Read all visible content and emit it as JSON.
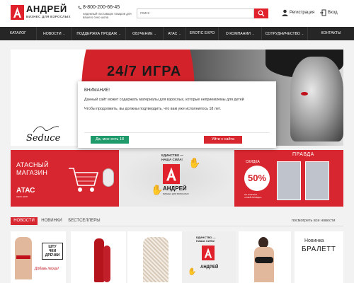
{
  "header": {
    "logo_letter": "А",
    "logo_name": "АНДРЕЙ",
    "logo_subtitle": "БИЗНЕС ДЛЯ ВЗРОСЛЫХ",
    "phone": "8-800-200-66-45",
    "tagline": "надежный поставщик товаров для вашего секс-шопа",
    "search_placeholder": "поиск",
    "register_label": "Регистрация",
    "login_label": "Вход"
  },
  "nav": {
    "items": [
      {
        "label": "КАТАЛОГ",
        "has_dropdown": false
      },
      {
        "label": "НОВОСТИ",
        "has_dropdown": true
      },
      {
        "label": "ПОДДЕРЖКА ПРОДАЖ",
        "has_dropdown": true
      },
      {
        "label": "ОБУЧЕНИЕ",
        "has_dropdown": true
      },
      {
        "label": "АТАС",
        "has_dropdown": true
      },
      {
        "label": "EROTIC EXPO",
        "has_dropdown": false
      },
      {
        "label": "О КОМПАНИИ",
        "has_dropdown": true
      },
      {
        "label": "СОТРУДНИЧЕСТВО",
        "has_dropdown": true
      },
      {
        "label": "КОНТАКТЫ",
        "has_dropdown": false
      }
    ]
  },
  "hero": {
    "title": "24/7 ИГРА",
    "brand_signature": "Seduce"
  },
  "modal": {
    "title": "ВНИМАНИЕ!",
    "line1": "Данный сайт может содержать материалы для взрослых, которые неприемлемы для детей",
    "line2": "Чтобы продолжить, вы должны подтвердить, что вам уже исполнилось 18 лет.",
    "confirm_label": "Да, мне есть 18",
    "leave_label": "Уйти с сайта"
  },
  "promos": {
    "atas": {
      "title_line1": "АТАСНЫЙ",
      "title_line2": "МАГАЗИН",
      "brand": "АТАС",
      "brand_sub": "СЕКС ШОП"
    },
    "unity": {
      "label_line1": "ЕДИНСТВО —",
      "label_line2": "НАША СИЛА!",
      "name": "АНДРЕЙ",
      "sub": "БИЗНЕС ДЛЯ ВЗРОСЛЫХ"
    },
    "pravda": {
      "magazine": "ПРАВДА",
      "discount_label": "СКИДКА",
      "discount_value": "50%",
      "magazine_note_line1": "НА ЖУРНАЛ",
      "magazine_note_line2": "«ПЛЕЙ-ПРАВДА»"
    }
  },
  "tabs": {
    "items": [
      {
        "label": "НОВОСТИ",
        "active": true
      },
      {
        "label": "НОВИНКИ",
        "active": false
      },
      {
        "label": "БЕСТСЕЛЛЕРЫ",
        "active": false
      }
    ],
    "see_all": "посмотреть все новости"
  },
  "cards": {
    "c1": {
      "box_label_line1": "ШТУ",
      "box_label_line2": "ЧКИ",
      "box_label_line3": "ДРЕЧКИ",
      "slogan": "Добавь перца!"
    },
    "c4": {
      "label_line1": "ЕДИНСТВО —",
      "label_line2": "НАША СИЛА!",
      "name": "АНДРЕЙ"
    },
    "c6": {
      "line1": "Новинка",
      "line2": "БРАЛЕТТ"
    }
  },
  "colors": {
    "brand_red": "#d7262f",
    "nav_bg": "#262626",
    "confirm_green": "#1f9a6a",
    "leave_red": "#d8262e"
  }
}
